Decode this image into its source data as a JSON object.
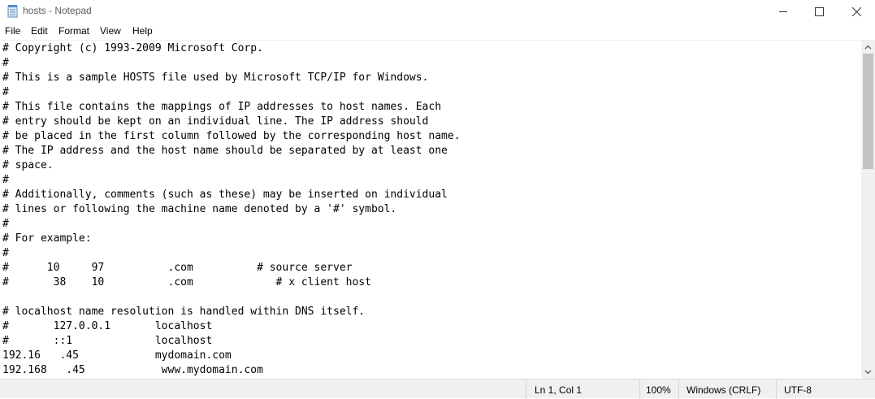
{
  "window": {
    "title": "hosts - Notepad"
  },
  "menu": [
    "File",
    "Edit",
    "Format",
    "View",
    "Help"
  ],
  "editor": {
    "lines": [
      "# Copyright (c) 1993-2009 Microsoft Corp.",
      "#",
      "# This is a sample HOSTS file used by Microsoft TCP/IP for Windows.",
      "#",
      "# This file contains the mappings of IP addresses to host names. Each",
      "# entry should be kept on an individual line. The IP address should",
      "# be placed in the first column followed by the corresponding host name.",
      "# The IP address and the host name should be separated by at least one",
      "# space.",
      "#",
      "# Additionally, comments (such as these) may be inserted on individual",
      "# lines or following the machine name denoted by a '#' symbol.",
      "#",
      "# For example:",
      "#",
      "#      10     97          .com          # source server",
      "#       38    10          .com             # x client host",
      "",
      "# localhost name resolution is handled within DNS itself.",
      "#       127.0.0.1       localhost",
      "#       ::1             localhost",
      "192.16   .45            mydomain.com",
      "192.168   .45            www.mydomain.com"
    ]
  },
  "status": {
    "position": "Ln 1, Col 1",
    "zoom": "100%",
    "line_ending": "Windows (CRLF)",
    "encoding": "UTF-8"
  }
}
